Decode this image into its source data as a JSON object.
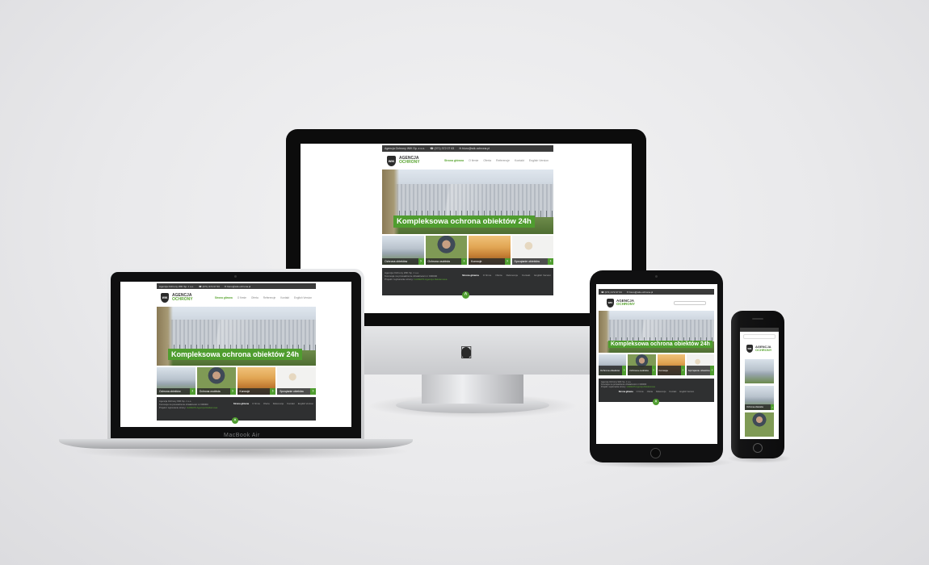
{
  "site": {
    "topbar": {
      "company": "Agencja Ochrony WIK Sp. z o.o.",
      "phone": "☎ (071) 372 07 63",
      "email": "✉ biuro@wik-ochrona.pl"
    },
    "logo": {
      "badge": "WIK",
      "line1": "AGENCJA",
      "line2": "OCHRONY"
    },
    "nav": [
      "Strona główna",
      "O firmie",
      "Oferta",
      "Referencje",
      "Kontakt",
      "English Version"
    ],
    "hero_title": "Kompleksowa ochrona obiektów 24h",
    "tiles": [
      "Ochrona obiektów",
      "Ochrona osobista",
      "Konwoje",
      "Sprzątanie obiektów"
    ],
    "tile_arrow": "›",
    "footer": {
      "line1": "Agencja Ochrony WIK Sp. z o.o.",
      "line2": "Koncesja na prowadzenie działalności nr 000000",
      "line3_prefix": "Projekt i wykonanie strony:",
      "line3_link": "GADEOS Agencja Reklamowa",
      "nav": [
        "Strona główna",
        "O firmie",
        "Oferta",
        "Referencje",
        "Kontakt",
        "English Version"
      ],
      "up": "˄"
    }
  },
  "devices": {
    "laptop_label": "MacBook Air"
  },
  "colors": {
    "accent": "#5aa532",
    "dark": "#2f3031"
  }
}
